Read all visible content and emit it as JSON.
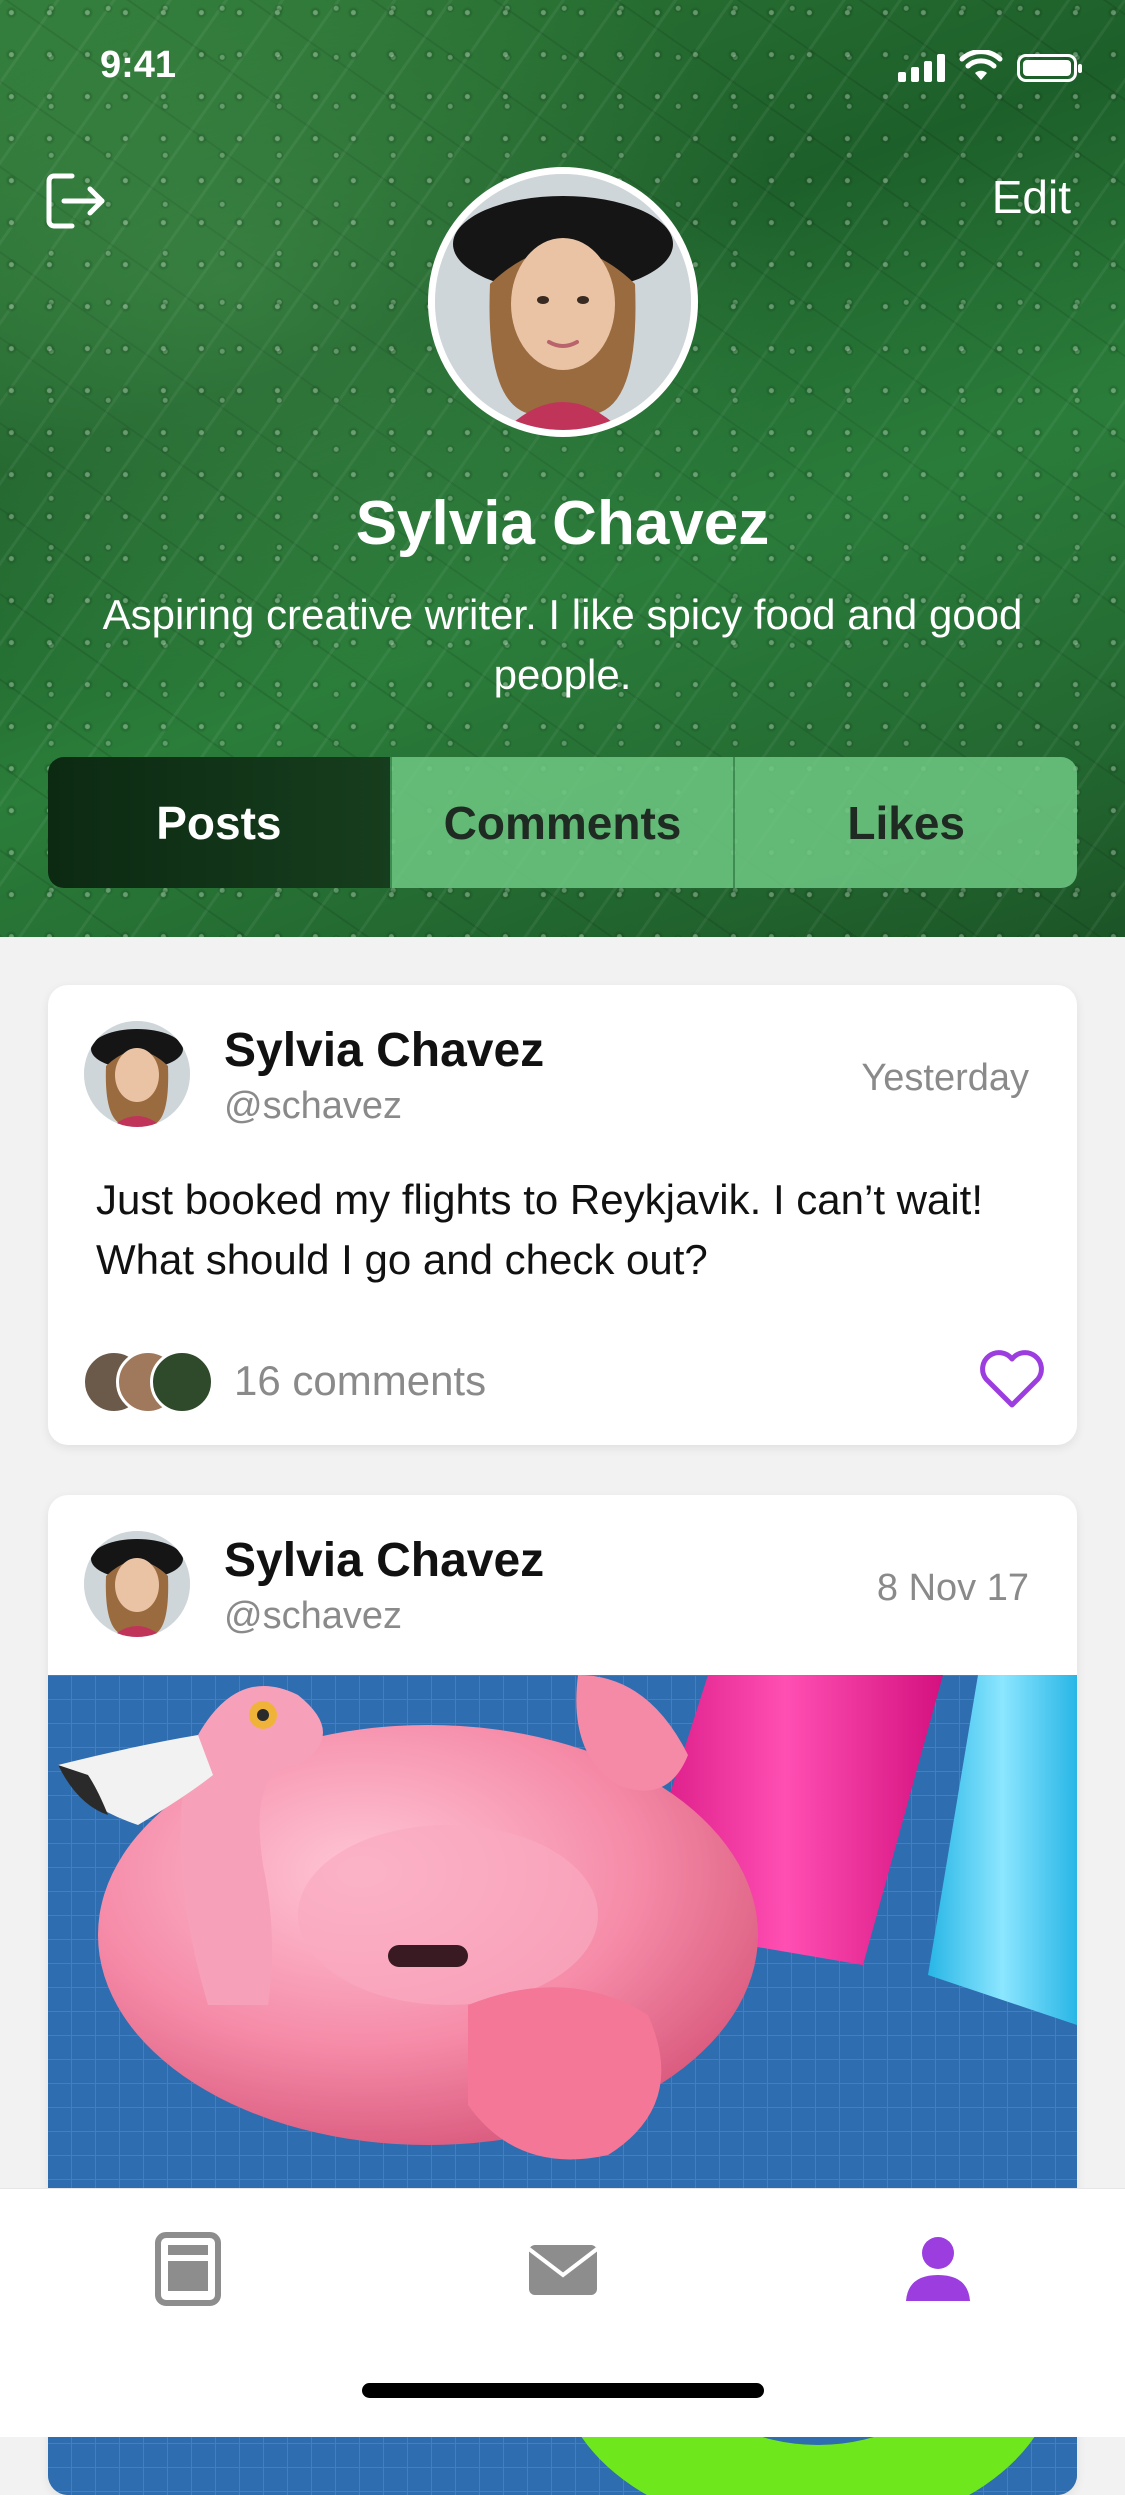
{
  "status_bar": {
    "time": "9:41"
  },
  "header": {
    "edit_label": "Edit"
  },
  "profile": {
    "name": "Sylvia Chavez",
    "bio": "Aspiring creative writer. I like spicy food and good people."
  },
  "tabs": [
    {
      "label": "Posts",
      "active": true
    },
    {
      "label": "Comments",
      "active": false
    },
    {
      "label": "Likes",
      "active": false
    }
  ],
  "posts": [
    {
      "author": "Sylvia Chavez",
      "handle": "@schavez",
      "date": "Yesterday",
      "text": "Just booked my flights to Reykjavik. I can’t wait! What should I go and check out?",
      "comments_label": "16 comments"
    },
    {
      "author": "Sylvia Chavez",
      "handle": "@schavez",
      "date": "8 Nov 17"
    }
  ],
  "colors": {
    "accent": "#9b3ddf",
    "tab_active": "#0c2a12",
    "tab_inactive": "#6ec882",
    "muted_text": "#8a8a8a"
  },
  "bottom_tabs": [
    {
      "icon": "feed-icon",
      "active": false
    },
    {
      "icon": "mail-icon",
      "active": false
    },
    {
      "icon": "profile-icon",
      "active": true
    }
  ]
}
